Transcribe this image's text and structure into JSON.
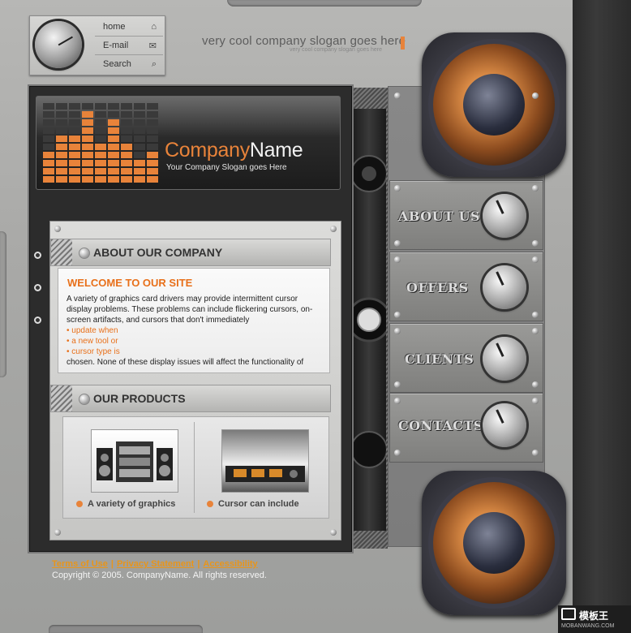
{
  "nav": {
    "items": [
      {
        "label": "home",
        "icon": "home-icon"
      },
      {
        "label": "E-mail",
        "icon": "mail-icon"
      },
      {
        "label": "Search",
        "icon": "search-icon"
      }
    ]
  },
  "slogan": "very cool company slogan goes here",
  "slogan_mirror": "very cool company slogan goes here",
  "header": {
    "brand_part1": "Company",
    "brand_part2": "Name",
    "tagline": "Your Company Slogan goes Here"
  },
  "about": {
    "heading": "ABOUT OUR COMPANY",
    "welcome": "WELCOME TO OUR SITE",
    "para1": "A variety of graphics card drivers may provide intermittent cursor display problems. These problems can include flickering cursors, on-screen artifacts, and cursors that don't immediately",
    "bullets": [
      "• update when",
      "• a new tool or",
      "• cursor type is"
    ],
    "para2": "chosen. None of these display issues will affect the functionality of"
  },
  "products": {
    "heading": "OUR PRODUCTS",
    "items": [
      {
        "label": "A variety of graphics"
      },
      {
        "label": "Cursor can include"
      }
    ]
  },
  "menu": {
    "items": [
      {
        "label": "ABOUT US"
      },
      {
        "label": "OFFERS"
      },
      {
        "label": "CLIENTS"
      },
      {
        "label": "CONTACTS"
      }
    ]
  },
  "footer": {
    "links": [
      "Terms of Use",
      "Privacy Statement",
      "Accessibility"
    ],
    "separator": "|",
    "copyright": "Copyright © 2005. CompanyName. All rights reserved."
  },
  "watermark": {
    "title": "模板王",
    "url": "MOBANWANG.COM"
  },
  "colors": {
    "accent": "#e8833a",
    "panel_dark": "#2c2c2c",
    "metal": "#a9a9a7"
  }
}
